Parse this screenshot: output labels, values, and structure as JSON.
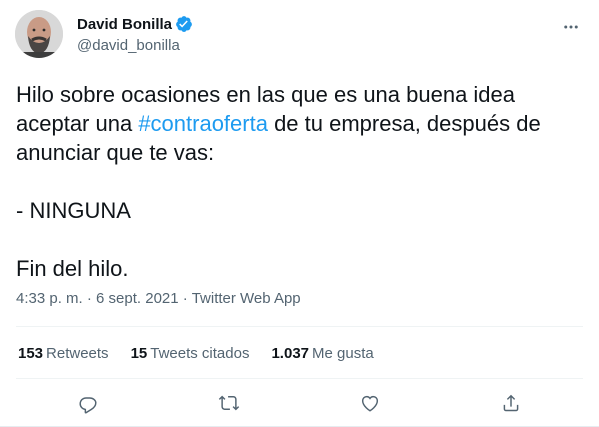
{
  "author": {
    "display_name": "David Bonilla",
    "handle": "@david_bonilla",
    "verified_icon": "verified-badge-icon",
    "avatar_colors": {
      "background": "#d8d8d8",
      "skin": "#c99b86",
      "beard": "#4a4543"
    }
  },
  "tweet": {
    "line1": "Hilo sobre ocasiones en las que es una buena idea",
    "line2_before": "aceptar una ",
    "hashtag": "#contraoferta",
    "line2_after": " de tu empresa, después de",
    "line3": "anunciar que te vas:",
    "line4": "- NINGUNA",
    "line5": "Fin del hilo."
  },
  "meta": {
    "time": "4:33 p. m.",
    "separator1": " · ",
    "date": "6 sept. 2021",
    "separator2": " · ",
    "app": "Twitter Web App"
  },
  "stats": {
    "retweets_count": "153",
    "retweets_label": "Retweets",
    "quotes_count": "15",
    "quotes_label": "Tweets citados",
    "likes_count": "1.037",
    "likes_label": "Me gusta"
  },
  "actions": [
    "reply-icon",
    "retweet-icon",
    "like-icon",
    "share-icon"
  ],
  "colors": {
    "accent": "#1d9bf0",
    "text": "#0f1419",
    "secondary": "#536471",
    "border": "#eff3f4"
  }
}
